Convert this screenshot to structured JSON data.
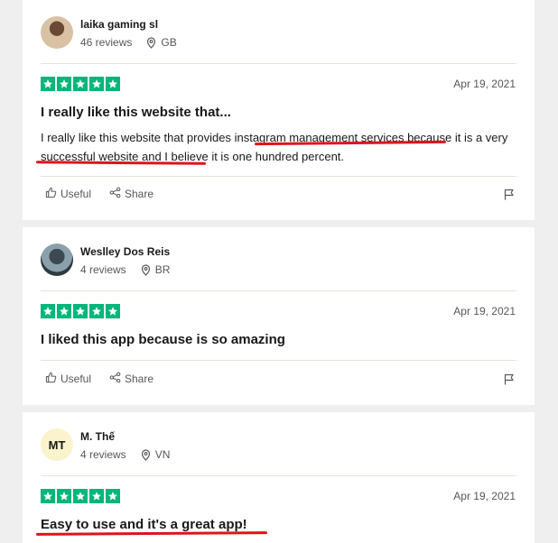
{
  "reviews": [
    {
      "consumer": {
        "name": "laika gaming sl",
        "reviews": "46 reviews",
        "country": "GB",
        "initials": ""
      },
      "rating": 5,
      "date": "Apr 19, 2021",
      "title": "I really like this website that...",
      "body": "I really like this website that provides instagram management services because it is a very successful website and I believe it is one hundred percent.",
      "useful_label": "Useful",
      "share_label": "Share"
    },
    {
      "consumer": {
        "name": "Weslley Dos Reis",
        "reviews": "4 reviews",
        "country": "BR",
        "initials": ""
      },
      "rating": 5,
      "date": "Apr 19, 2021",
      "title": "I liked this app because is so amazing",
      "body": "",
      "useful_label": "Useful",
      "share_label": "Share"
    },
    {
      "consumer": {
        "name": "M. Thế",
        "reviews": "4 reviews",
        "country": "VN",
        "initials": "MT"
      },
      "rating": 5,
      "date": "Apr 19, 2021",
      "title": "Easy to use and it's a great app!",
      "body": ""
    }
  ],
  "colors": {
    "star": "#00b67a",
    "annotation": "#e0131b",
    "avatar_initials_bg": "#fbf3cc"
  },
  "icons": {
    "location": "map-pin-icon",
    "useful": "thumbs-up-icon",
    "share": "share-icon",
    "report": "flag-icon",
    "star": "star-icon"
  }
}
